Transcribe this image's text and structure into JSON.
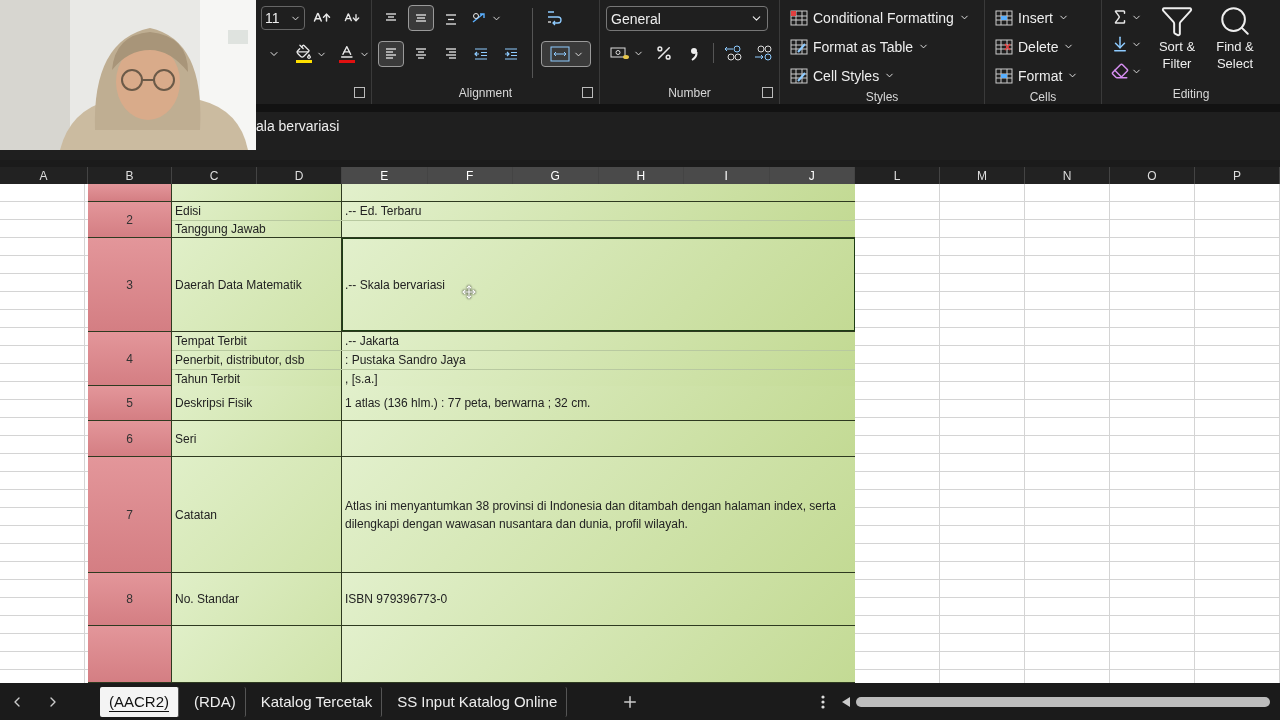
{
  "ribbon": {
    "font": {
      "size": "11"
    },
    "alignment": {
      "label": "Alignment",
      "vertical": [
        {
          "selected": false
        },
        {
          "selected": true
        },
        {
          "selected": false
        }
      ],
      "horizontal": [
        {
          "selected": true
        },
        {
          "selected": false
        },
        {
          "selected": false
        }
      ],
      "merge": {
        "selected": true
      }
    },
    "number": {
      "label": "Number",
      "format": "General"
    },
    "styles": {
      "label": "Styles",
      "items": [
        "Conditional Formatting",
        "Format as Table",
        "Cell Styles"
      ]
    },
    "cells": {
      "label": "Cells",
      "items": [
        "Insert",
        "Delete",
        "Format"
      ]
    },
    "editing": {
      "label": "Editing",
      "buttons": [
        "Sort & Filter",
        "Find & Select"
      ]
    }
  },
  "formula_bar": {
    "value": "ala bervariasi"
  },
  "columns": [
    {
      "label": "A",
      "selected": false
    },
    {
      "label": "B",
      "selected": false
    },
    {
      "label": "C",
      "selected": false
    },
    {
      "label": "D",
      "selected": false
    },
    {
      "label": "E",
      "selected": true
    },
    {
      "label": "F",
      "selected": true
    },
    {
      "label": "G",
      "selected": true
    },
    {
      "label": "H",
      "selected": true
    },
    {
      "label": "I",
      "selected": true
    },
    {
      "label": "J",
      "selected": true
    },
    {
      "label": "L",
      "selected": false
    },
    {
      "label": "M",
      "selected": false
    },
    {
      "label": "N",
      "selected": false
    },
    {
      "label": "O",
      "selected": false
    },
    {
      "label": "P",
      "selected": false
    }
  ],
  "entries": [
    {
      "number": "2",
      "fields": [
        {
          "label": "Edisi",
          "value": ".-- Ed. Terbaru",
          "selected": false
        },
        {
          "label": "Tanggung Jawab",
          "selected": false
        }
      ]
    },
    {
      "number": "3",
      "fields": [
        {
          "label": "Daerah Data Matematik",
          "value": ".-- Skala bervariasi",
          "selected": true
        }
      ]
    },
    {
      "number": "4",
      "fields": [
        {
          "label": "Tempat Terbit",
          "value": ".-- Jakarta",
          "selected": false
        },
        {
          "label": "Penerbit, distributor, dsb",
          "value": ": Pustaka Sandro Jaya",
          "selected": false
        },
        {
          "label": "Tahun Terbit",
          "value": ", [s.a.]",
          "selected": false
        }
      ]
    },
    {
      "number": "5",
      "fields": [
        {
          "label": "Deskripsi Fisik",
          "value": "1 atlas (136 hlm.) : 77 peta, berwarna ; 32 cm.",
          "selected": false
        }
      ]
    },
    {
      "number": "6",
      "fields": [
        {
          "label": "Seri",
          "selected": false
        }
      ]
    },
    {
      "number": "7",
      "fields": [
        {
          "label": "Catatan",
          "value": "Atlas ini menyantumkan 38 provinsi di Indonesia dan ditambah dengan halaman index, serta dilengkapi dengan wawasan nusantara dan dunia, profil wilayah.",
          "selected": false
        }
      ]
    },
    {
      "number": "8",
      "fields": [
        {
          "label": "No. Standar",
          "value": "ISBN 979396773-0",
          "selected": false
        }
      ]
    }
  ],
  "sheet_tabs": [
    {
      "label": "(AACR2)",
      "selected": true
    },
    {
      "label": "(RDA)",
      "selected": false
    },
    {
      "label": "Katalog Tercetak",
      "selected": false
    },
    {
      "label": "SS Input Katalog Online",
      "selected": false
    }
  ]
}
